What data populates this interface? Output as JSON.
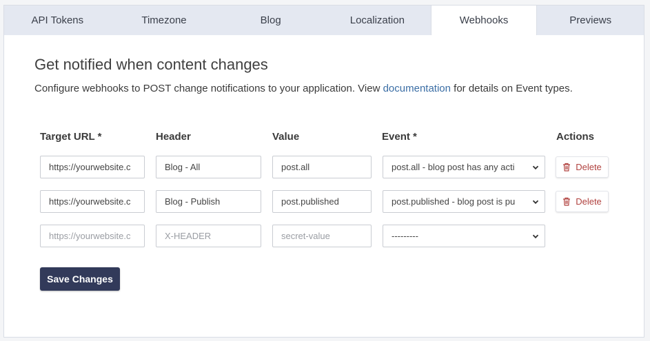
{
  "tabs": [
    {
      "label": "API Tokens",
      "active": false
    },
    {
      "label": "Timezone",
      "active": false
    },
    {
      "label": "Blog",
      "active": false
    },
    {
      "label": "Localization",
      "active": false
    },
    {
      "label": "Webhooks",
      "active": true
    },
    {
      "label": "Previews",
      "active": false
    }
  ],
  "heading": "Get notified when content changes",
  "description": {
    "before": "Configure webhooks to POST change notifications to your application. View ",
    "link": "documentation",
    "after": " for details on Event types."
  },
  "columns": {
    "target_url": "Target URL *",
    "header": "Header",
    "value": "Value",
    "event": "Event *",
    "actions": "Actions"
  },
  "rows": [
    {
      "target_url": "https://yourwebsite.c",
      "header": "Blog - All",
      "value": "post.all",
      "event": "post.all - blog post has any acti",
      "delete": "Delete"
    },
    {
      "target_url": "https://yourwebsite.c",
      "header": "Blog - Publish",
      "value": "post.published",
      "event": "post.published - blog post is pu",
      "delete": "Delete"
    }
  ],
  "new_row": {
    "target_url_placeholder": "https://yourwebsite.c",
    "header_placeholder": "X-HEADER",
    "value_placeholder": "secret-value",
    "event": "---------"
  },
  "save_label": "Save Changes",
  "colors": {
    "tab_bar": "#e4e8f1",
    "link": "#3b6ea5",
    "delete": "#b0413e",
    "save_button": "#323a5a"
  }
}
